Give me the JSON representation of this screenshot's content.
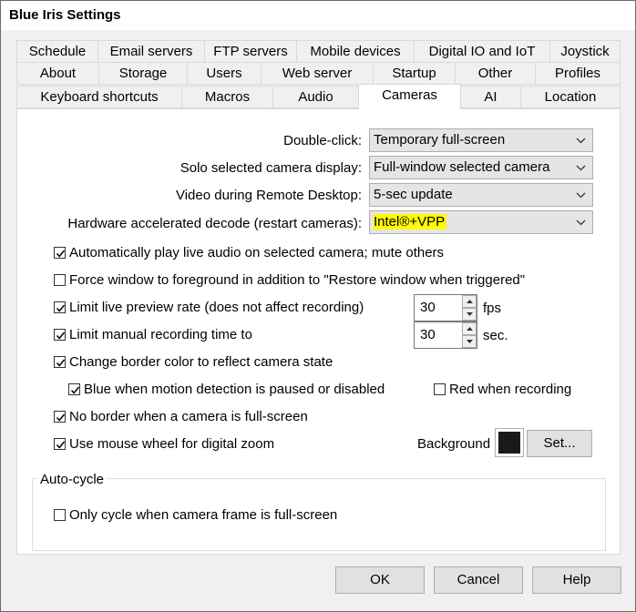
{
  "window": {
    "title": "Blue Iris Settings"
  },
  "tabs": {
    "row1": [
      "Schedule",
      "Email servers",
      "FTP servers",
      "Mobile devices",
      "Digital IO and IoT",
      "Joystick"
    ],
    "row2": [
      "About",
      "Storage",
      "Users",
      "Web server",
      "Startup",
      "Other",
      "Profiles"
    ],
    "row3": [
      "Keyboard shortcuts",
      "Macros",
      "Audio",
      "Cameras",
      "AI",
      "Location"
    ]
  },
  "settings": {
    "double_click": {
      "label": "Double-click:",
      "value": "Temporary full-screen"
    },
    "solo_display": {
      "label": "Solo selected camera display:",
      "value": "Full-window selected camera"
    },
    "remote_desktop": {
      "label": "Video during Remote Desktop:",
      "value": "5-sec update"
    },
    "hw_decode": {
      "label": "Hardware accelerated decode (restart cameras):",
      "value": "Intel®+VPP"
    }
  },
  "checks": {
    "auto_audio": {
      "label": "Automatically play live audio on selected camera; mute others",
      "checked": true
    },
    "force_foreground": {
      "label": "Force window to foreground in addition to \"Restore window when triggered\"",
      "checked": false
    },
    "limit_preview": {
      "label": "Limit live preview rate (does not affect recording)",
      "checked": true,
      "value": "30",
      "unit": "fps"
    },
    "limit_manual": {
      "label": "Limit manual recording time to",
      "checked": true,
      "value": "30",
      "unit": "sec."
    },
    "border_color": {
      "label": "Change border color to reflect camera state",
      "checked": true
    },
    "blue_motion": {
      "label": "Blue when motion detection is paused or disabled",
      "checked": true
    },
    "red_recording": {
      "label": "Red when recording",
      "checked": false
    },
    "no_border": {
      "label": "No border when a camera is full-screen",
      "checked": true
    },
    "mouse_wheel": {
      "label": "Use mouse wheel for digital zoom",
      "checked": true
    }
  },
  "background": {
    "label": "Background",
    "button": "Set...",
    "color": "#1a1a1a"
  },
  "auto_cycle": {
    "title": "Auto-cycle",
    "only_fullscreen": {
      "label": "Only cycle when camera frame is full-screen",
      "checked": false
    }
  },
  "buttons": {
    "ok": "OK",
    "cancel": "Cancel",
    "help": "Help"
  },
  "colors": {
    "highlight": "#fffb00"
  }
}
